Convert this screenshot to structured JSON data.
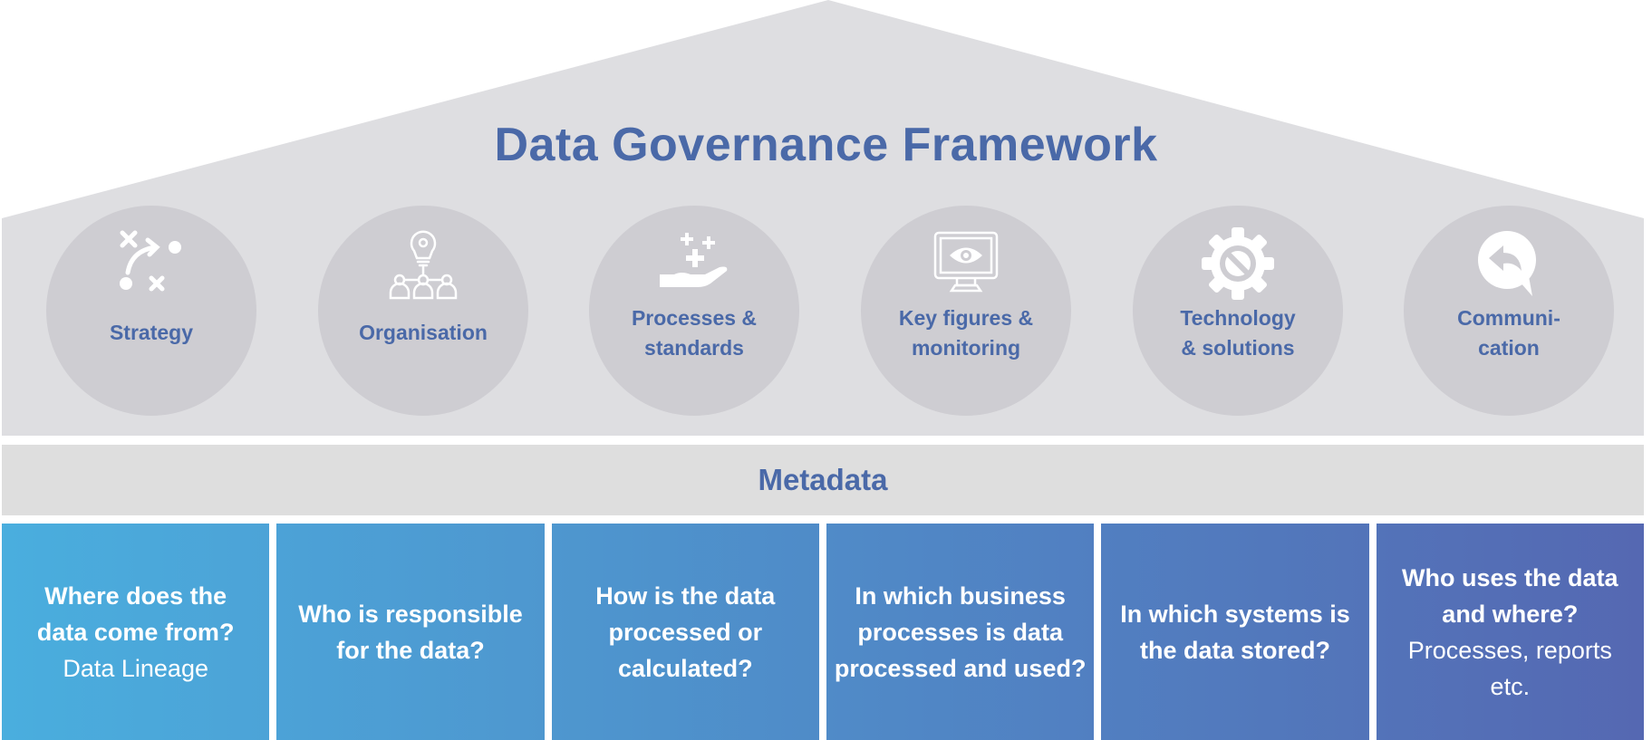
{
  "title": "Data Governance Framework",
  "colors": {
    "house_fill": "#dedee1",
    "pillar_fill": "#cecdd2",
    "accent_text": "#4a69a8",
    "metadata_fill": "#dedede",
    "box_gradient_start": "#4aaede",
    "box_gradient_end": "#5568b2"
  },
  "pillars": [
    {
      "label": "Strategy",
      "icon": "strategy-play-icon"
    },
    {
      "label": "Organisation",
      "icon": "lightbulb-team-icon"
    },
    {
      "label": "Processes &\nstandards",
      "line1": "Processes &",
      "line2": "standards",
      "icon": "hand-plus-icon"
    },
    {
      "label": "Key figures &\nmonitoring",
      "line1": "Key figures &",
      "line2": "monitoring",
      "icon": "monitor-eye-icon"
    },
    {
      "label": "Technology\n& solutions",
      "line1": "Technology",
      "line2": "& solutions",
      "icon": "gear-icon"
    },
    {
      "label": "Communi-\ncation",
      "line1": "Communi-",
      "line2": "cation",
      "icon": "chat-reply-icon"
    }
  ],
  "metadata": {
    "label": "Metadata"
  },
  "questions": [
    {
      "lines": [
        "Where does the",
        "data come from?"
      ],
      "answer": [
        "Data Lineage"
      ]
    },
    {
      "lines": [
        "Who is responsible",
        "for the data?"
      ],
      "answer": []
    },
    {
      "lines": [
        "How is the data",
        "processed or",
        "calculated?"
      ],
      "answer": []
    },
    {
      "lines": [
        "In which business",
        "processes is data",
        "processed and used?"
      ],
      "answer": []
    },
    {
      "lines": [
        "In which systems is",
        "the data stored?"
      ],
      "answer": []
    },
    {
      "lines": [
        "Who uses the data",
        "and where?"
      ],
      "answer": [
        "Processes, reports",
        "etc."
      ]
    }
  ]
}
